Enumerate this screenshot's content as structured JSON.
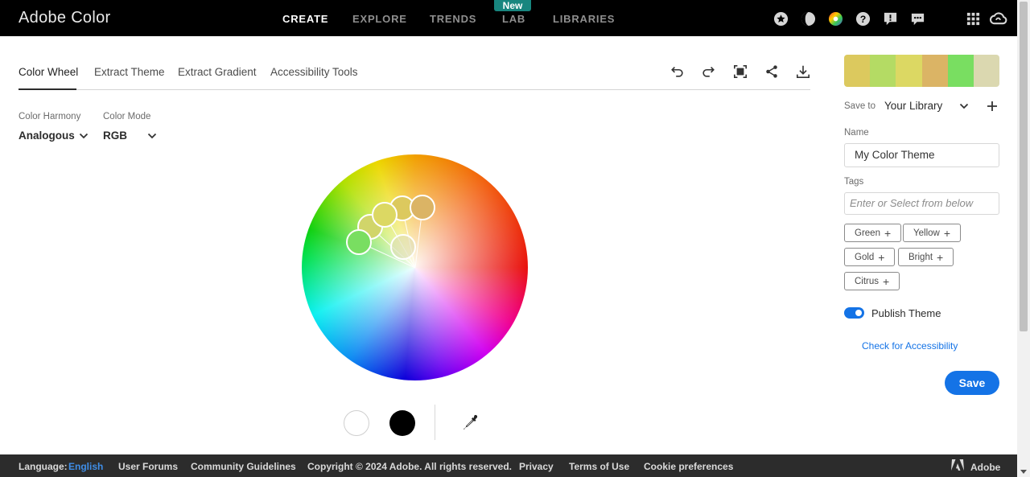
{
  "header": {
    "brand": "Adobe Color",
    "nav": [
      {
        "label": "CREATE",
        "active": true
      },
      {
        "label": "EXPLORE",
        "active": false
      },
      {
        "label": "TRENDS",
        "active": false
      },
      {
        "label": "LAB",
        "active": false
      },
      {
        "label": "LIBRARIES",
        "active": false
      }
    ],
    "lab_badge": "New",
    "icons": [
      "star-icon",
      "contrast-icon",
      "color-wheel-icon",
      "help-icon",
      "feedback-icon",
      "chat-icon",
      "apps-grid-icon",
      "creative-cloud-icon"
    ]
  },
  "tabs": [
    {
      "label": "Color Wheel",
      "active": true
    },
    {
      "label": "Extract Theme",
      "active": false
    },
    {
      "label": "Extract Gradient",
      "active": false
    },
    {
      "label": "Accessibility Tools",
      "active": false
    }
  ],
  "toolbar_icons": [
    "undo-icon",
    "redo-icon",
    "fullscreen-icon",
    "share-icon",
    "download-icon"
  ],
  "harmony": {
    "label": "Color Harmony",
    "value": "Analogous"
  },
  "mode": {
    "label": "Color Mode",
    "value": "RGB"
  },
  "theme_colors": [
    "#dcc95e",
    "#b4db64",
    "#dcd863",
    "#dbb465",
    "#79de61",
    "#dbd8b0"
  ],
  "sidebar": {
    "save_to_label": "Save to",
    "library": "Your Library",
    "name_label": "Name",
    "name_value": "My Color Theme",
    "tags_label": "Tags",
    "tags_placeholder": "Enter or Select from below",
    "tags": [
      "Green",
      "Yellow",
      "Gold",
      "Bright",
      "Citrus"
    ],
    "publish_label": "Publish Theme",
    "publish_on": true,
    "accessibility_link": "Check for Accessibility",
    "save_label": "Save"
  },
  "footer": {
    "language_label": "Language:",
    "language": "English",
    "links": [
      "User Forums",
      "Community Guidelines",
      "Copyright © 2024 Adobe. All rights reserved.",
      "Privacy",
      "Terms of Use",
      "Cookie preferences"
    ],
    "adobe": "Adobe"
  }
}
